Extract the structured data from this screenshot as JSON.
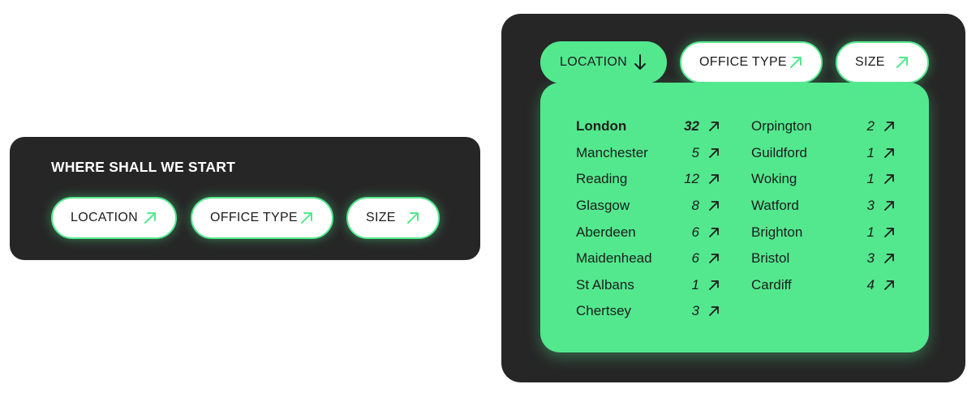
{
  "colors": {
    "accent": "#53e88e",
    "card_background": "#262626",
    "pill_background": "#ffffff",
    "text_dark": "#1d1d1d",
    "text_light": "#ffffff"
  },
  "left_card": {
    "title": "WHERE SHALL WE START",
    "filters": [
      {
        "label": "LOCATION",
        "icon": "arrow-up-right-icon"
      },
      {
        "label": "OFFICE TYPE",
        "icon": "arrow-up-right-icon"
      },
      {
        "label": "SIZE",
        "icon": "arrow-up-right-icon"
      }
    ]
  },
  "right_card": {
    "filters": [
      {
        "label": "LOCATION",
        "icon": "arrow-down-icon",
        "active": true
      },
      {
        "label": "OFFICE TYPE",
        "icon": "arrow-up-right-icon",
        "active": false
      },
      {
        "label": "SIZE",
        "icon": "arrow-up-right-icon",
        "active": false
      }
    ],
    "locations_col1": [
      {
        "name": "London",
        "count": "32",
        "selected": true
      },
      {
        "name": "Manchester",
        "count": "5"
      },
      {
        "name": "Reading",
        "count": "12"
      },
      {
        "name": "Glasgow",
        "count": "8"
      },
      {
        "name": "Aberdeen",
        "count": "6"
      },
      {
        "name": "Maidenhead",
        "count": "6"
      },
      {
        "name": "St Albans",
        "count": "1"
      },
      {
        "name": "Chertsey",
        "count": "3"
      }
    ],
    "locations_col2": [
      {
        "name": "Orpington",
        "count": "2"
      },
      {
        "name": "Guildford",
        "count": "1"
      },
      {
        "name": "Woking",
        "count": "1"
      },
      {
        "name": "Watford",
        "count": "3"
      },
      {
        "name": "Brighton",
        "count": "1"
      },
      {
        "name": "Bristol",
        "count": "3"
      },
      {
        "name": "Cardiff",
        "count": "4"
      }
    ]
  }
}
